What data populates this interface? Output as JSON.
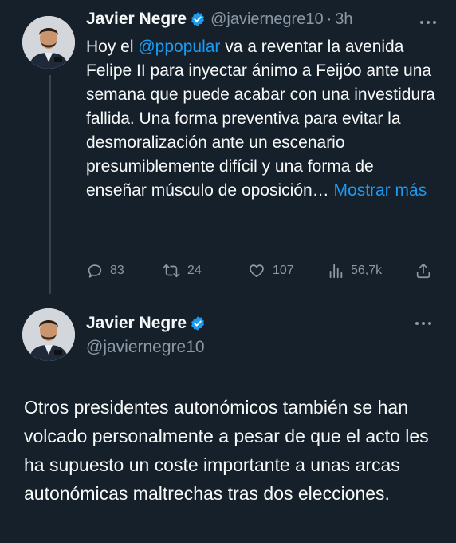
{
  "colors": {
    "background": "#15202b",
    "text": "#f7f9f9",
    "secondary": "#8b98a5",
    "accent": "#1d9bf0"
  },
  "tweet1": {
    "name": "Javier Negre",
    "handle": "@javiernegre10",
    "separator": "·",
    "time": "3h",
    "text_before_mention": "Hoy el ",
    "mention": "@ppopular",
    "text_after_mention": " va a reventar la avenida Felipe II para inyectar ánimo a Feijóo ante una semana que puede acabar con una investidura fallida. Una forma preventiva para evitar la desmoralización ante un escenario presumiblemente difícil y una forma de enseñar músculo de oposición… ",
    "show_more": "Mostrar más",
    "actions": {
      "replies": "83",
      "retweets": "24",
      "likes": "107",
      "views": "56,7k"
    }
  },
  "tweet2": {
    "name": "Javier Negre",
    "handle": "@javiernegre10",
    "text": "Otros presidentes autonómicos también se han volcado personalmente a pesar de que el acto les ha supuesto un coste importante a unas arcas autonómicas maltrechas tras dos elecciones."
  }
}
